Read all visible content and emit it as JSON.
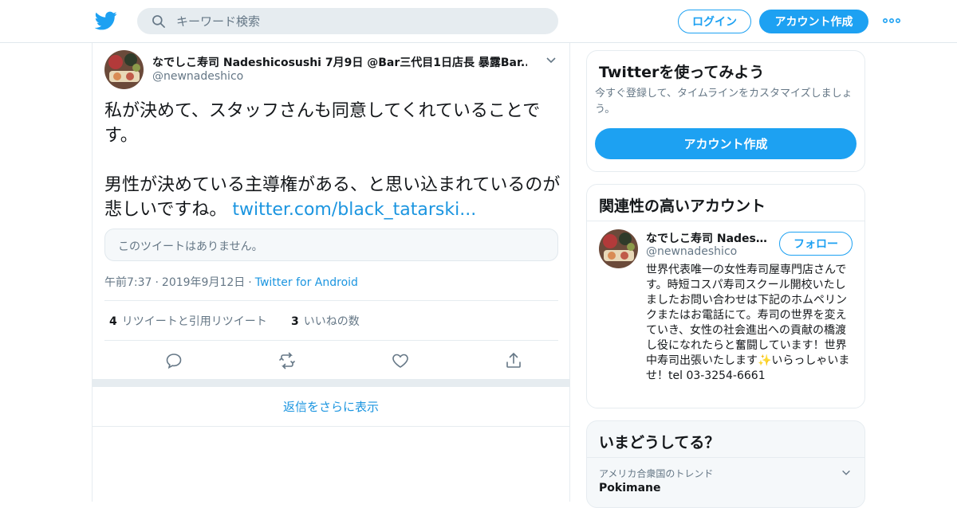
{
  "header": {
    "search_placeholder": "キーワード検索",
    "login_label": "ログイン",
    "signup_label": "アカウント作成",
    "brand_color": "#1da1f2"
  },
  "tweet": {
    "author_name": "なでしこ寿司 Nadeshicosushi 7月9日 @Bar三代目1日店長 暴露Bar...",
    "author_handle": "@newnadeshico",
    "text": "私が決めて、スタッフさんも同意してくれていることです。\n\n男性が決めている主導権がある、と思い込まれているのが悲しいですね。 ",
    "link": "twitter.com/black_tatarski...",
    "quote_unavailable": "このツイートはありません。",
    "time": "午前7:37",
    "date": "2019年9月12日",
    "via": "Twitter for Android",
    "retweets_count": "4",
    "retweets_label": "リツイートと引用リツイート",
    "likes_count": "3",
    "likes_label": "いいねの数",
    "more_replies": "返信をさらに表示"
  },
  "sidebar": {
    "try_card": {
      "title": "Twitterを使ってみよう",
      "subtitle": "今すぐ登録して、タイムラインをカスタマイズしましょう。",
      "button": "アカウント作成"
    },
    "related": {
      "title": "関連性の高いアカウント",
      "name": "なでしこ寿司 Nadeshicosushi",
      "handle": "@newnadeshico",
      "follow": "フォロー",
      "bio": "世界代表唯一の女性寿司屋専門店さんです。時短コスパ寿司スクール開校いたしましたお問い合わせは下記のホムペリンクまたはお電話にて。寿司の世界を変えていき、女性の社会進出への貢献の橋渡し役になれたらと奮闘しています！世界中寿司出張いたします✨いらっしゃいませ！tel 03-3254-6661"
    },
    "trends": {
      "title": "いまどうしてる？",
      "context": "アメリカ合衆国のトレンド",
      "name": "Pokimane"
    }
  }
}
